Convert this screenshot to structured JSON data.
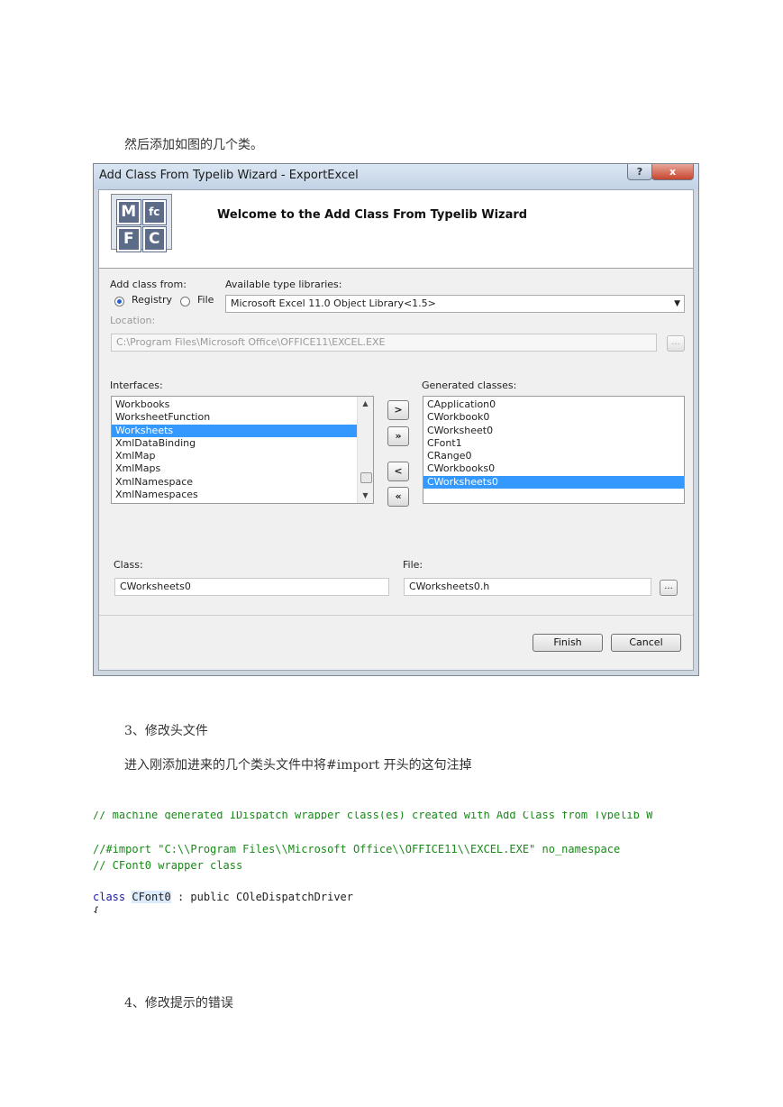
{
  "doc": {
    "intro": "然后添加如图的几个类。",
    "step3_heading": "3、修改头文件",
    "step3_text": "进入刚添加进来的几个类头文件中将#import 开头的这句注掉",
    "step4_heading": "4、修改提示的错误"
  },
  "dialog": {
    "title": "Add Class From Typelib Wizard - ExportExcel",
    "help_label": "?",
    "close_label": "x",
    "logo_letters": [
      "M",
      "fc",
      "F",
      "C"
    ],
    "heading": "Welcome to the Add Class From Typelib Wizard",
    "add_from_label": "Add class from:",
    "radio_registry": "Registry",
    "radio_file": "File",
    "available_label": "Available type libraries:",
    "library_value": "Microsoft Excel 11.0 Object Library<1.5>",
    "location_label": "Location:",
    "location_value": "C:\\Program Files\\Microsoft Office\\OFFICE11\\EXCEL.EXE",
    "browse_label": "...",
    "interfaces_label": "Interfaces:",
    "interfaces": [
      "Workbooks",
      "WorksheetFunction",
      "Worksheets",
      "XmlDataBinding",
      "XmlMap",
      "XmlMaps",
      "XmlNamespace",
      "XmlNamespaces"
    ],
    "interfaces_selected": "Worksheets",
    "move_buttons": [
      ">",
      "»",
      "<",
      "«"
    ],
    "generated_label": "Generated classes:",
    "generated": [
      "CApplication0",
      "CWorkbook0",
      "CWorksheet0",
      "CFont1",
      "CRange0",
      "CWorkbooks0",
      "CWorksheets0"
    ],
    "generated_selected": "CWorksheets0",
    "class_label": "Class:",
    "class_value": "CWorksheets0",
    "file_label": "File:",
    "file_value": "CWorksheets0.h",
    "finish_label": "Finish",
    "cancel_label": "Cancel"
  },
  "code": {
    "line_cut": "// machine generated IDispatch wrapper class(es) created with Add Class from Typelib W",
    "line_import": "//#import \"C:\\\\Program Files\\\\Microsoft Office\\\\OFFICE11\\\\EXCEL.EXE\" no_namespace",
    "line_comment": "// CFont0 wrapper class",
    "kw_class": "class",
    "class_name": "CFont0",
    "line_rest": " : public COleDispatchDriver",
    "brace": "{"
  }
}
